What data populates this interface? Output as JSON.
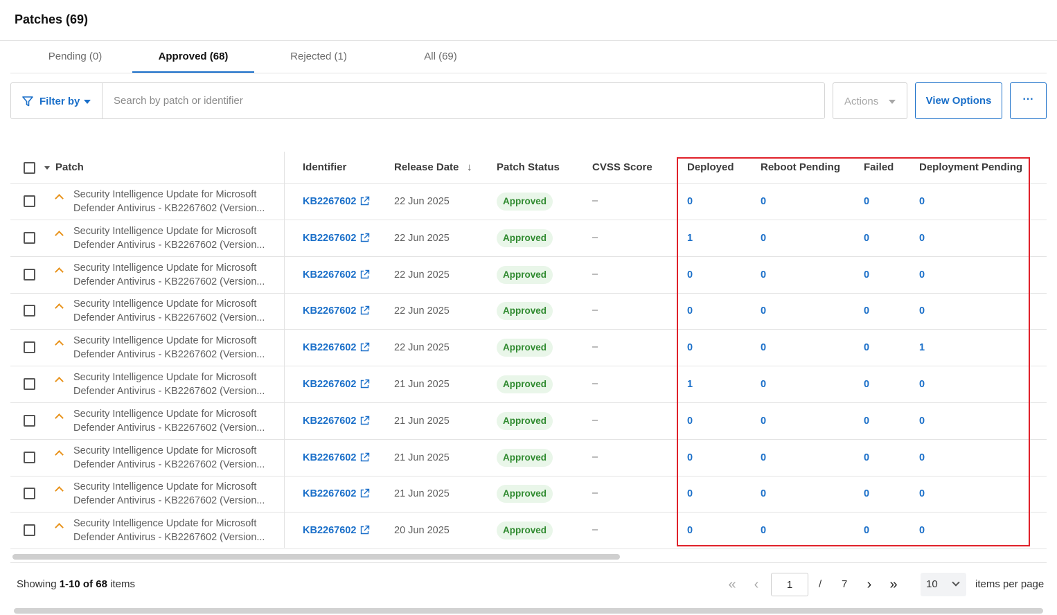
{
  "header": {
    "title": "Patches (69)"
  },
  "tabs": [
    {
      "label": "Pending (0)"
    },
    {
      "label": "Approved (68)"
    },
    {
      "label": "Rejected (1)"
    },
    {
      "label": "All (69)"
    }
  ],
  "active_tab": "Approved (68)",
  "toolbar": {
    "filter_label": "Filter by",
    "search_placeholder": "Search by patch or identifier",
    "actions_label": "Actions",
    "view_options_label": "View Options",
    "more_label": "···"
  },
  "table": {
    "columns": {
      "patch": "Patch",
      "identifier": "Identifier",
      "release_date": "Release Date",
      "patch_status": "Patch Status",
      "cvss_score": "CVSS Score",
      "deployed": "Deployed",
      "reboot_pending": "Reboot Pending",
      "failed": "Failed",
      "deployment_pending": "Deployment Pending"
    },
    "sort_indicator": "↓",
    "rows": [
      {
        "name_line1": "Security Intelligence Update for Microsoft",
        "name_line2": "Defender Antivirus - KB2267602 (Version...",
        "identifier": "KB2267602",
        "release_date": "22 Jun 2025",
        "status": "Approved",
        "cvss": "–",
        "deployed": "0",
        "reboot_pending": "0",
        "failed": "0",
        "deployment_pending": "0"
      },
      {
        "name_line1": "Security Intelligence Update for Microsoft",
        "name_line2": "Defender Antivirus - KB2267602 (Version...",
        "identifier": "KB2267602",
        "release_date": "22 Jun 2025",
        "status": "Approved",
        "cvss": "–",
        "deployed": "1",
        "reboot_pending": "0",
        "failed": "0",
        "deployment_pending": "0"
      },
      {
        "name_line1": "Security Intelligence Update for Microsoft",
        "name_line2": "Defender Antivirus - KB2267602 (Version...",
        "identifier": "KB2267602",
        "release_date": "22 Jun 2025",
        "status": "Approved",
        "cvss": "–",
        "deployed": "0",
        "reboot_pending": "0",
        "failed": "0",
        "deployment_pending": "0"
      },
      {
        "name_line1": "Security Intelligence Update for Microsoft",
        "name_line2": "Defender Antivirus - KB2267602 (Version...",
        "identifier": "KB2267602",
        "release_date": "22 Jun 2025",
        "status": "Approved",
        "cvss": "–",
        "deployed": "0",
        "reboot_pending": "0",
        "failed": "0",
        "deployment_pending": "0"
      },
      {
        "name_line1": "Security Intelligence Update for Microsoft",
        "name_line2": "Defender Antivirus - KB2267602 (Version...",
        "identifier": "KB2267602",
        "release_date": "22 Jun 2025",
        "status": "Approved",
        "cvss": "–",
        "deployed": "0",
        "reboot_pending": "0",
        "failed": "0",
        "deployment_pending": "1"
      },
      {
        "name_line1": "Security Intelligence Update for Microsoft",
        "name_line2": "Defender Antivirus - KB2267602 (Version...",
        "identifier": "KB2267602",
        "release_date": "21 Jun 2025",
        "status": "Approved",
        "cvss": "–",
        "deployed": "1",
        "reboot_pending": "0",
        "failed": "0",
        "deployment_pending": "0"
      },
      {
        "name_line1": "Security Intelligence Update for Microsoft",
        "name_line2": "Defender Antivirus - KB2267602 (Version...",
        "identifier": "KB2267602",
        "release_date": "21 Jun 2025",
        "status": "Approved",
        "cvss": "–",
        "deployed": "0",
        "reboot_pending": "0",
        "failed": "0",
        "deployment_pending": "0"
      },
      {
        "name_line1": "Security Intelligence Update for Microsoft",
        "name_line2": "Defender Antivirus - KB2267602 (Version...",
        "identifier": "KB2267602",
        "release_date": "21 Jun 2025",
        "status": "Approved",
        "cvss": "–",
        "deployed": "0",
        "reboot_pending": "0",
        "failed": "0",
        "deployment_pending": "0"
      },
      {
        "name_line1": "Security Intelligence Update for Microsoft",
        "name_line2": "Defender Antivirus - KB2267602 (Version...",
        "identifier": "KB2267602",
        "release_date": "21 Jun 2025",
        "status": "Approved",
        "cvss": "–",
        "deployed": "0",
        "reboot_pending": "0",
        "failed": "0",
        "deployment_pending": "0"
      },
      {
        "name_line1": "Security Intelligence Update for Microsoft",
        "name_line2": "Defender Antivirus - KB2267602 (Version...",
        "identifier": "KB2267602",
        "release_date": "20 Jun 2025",
        "status": "Approved",
        "cvss": "–",
        "deployed": "0",
        "reboot_pending": "0",
        "failed": "0",
        "deployment_pending": "0"
      }
    ]
  },
  "footer": {
    "showing_prefix": "Showing ",
    "showing_range": "1-10",
    "showing_of": " of ",
    "showing_total": "68",
    "showing_suffix": " items",
    "current_page": "1",
    "page_separator": "/",
    "total_pages": "7",
    "first_page_glyph": "«",
    "prev_page_glyph": "‹",
    "next_page_glyph": "›",
    "last_page_glyph": "»",
    "per_page_value": "10",
    "per_page_label": "items per page"
  },
  "colors": {
    "accent": "#1a6fc9",
    "highlight_border": "#e0212a",
    "approved_bg": "#e9f6e9",
    "approved_text": "#2f8a2f",
    "severity_chevron": "#e8931c"
  },
  "icons": {
    "filter": "funnel-icon",
    "external_link": "external-link-icon",
    "severity": "chevron-up-icon",
    "sort": "arrow-down-icon"
  }
}
